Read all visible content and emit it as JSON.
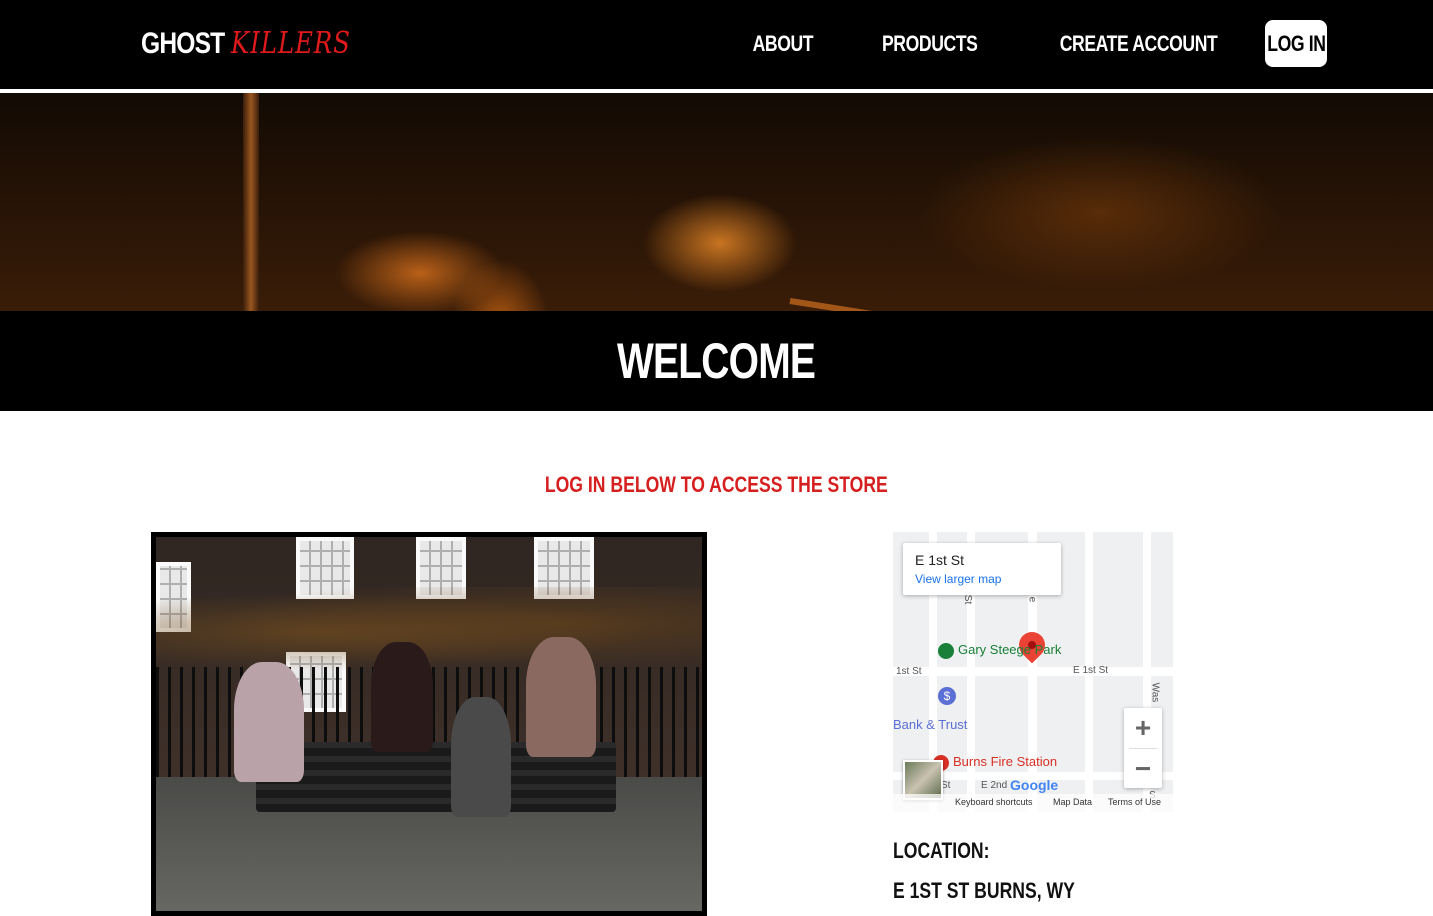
{
  "header": {
    "logo_white": "GHOST",
    "logo_red": "KILLERS",
    "nav": [
      "ABOUT",
      "PRODUCTS",
      "CREATE ACCOUNT"
    ],
    "login_label": "LOG IN"
  },
  "hero": {
    "title": "WELCOME"
  },
  "main": {
    "login_message": "LOG IN BELOW TO ACCESS THE STORE"
  },
  "map": {
    "card_title": "E 1st St",
    "card_link": "View larger map",
    "poi_park": "Gary Steege Park",
    "poi_bank": "Bank & Trust",
    "poi_fire": "Burns Fire Station",
    "street_e1st": "E 1st St",
    "street_1st": "1st St",
    "street_e2nd": "E 2nd",
    "street_st": "St",
    "street_was": "Was",
    "street_s": "S",
    "street_v_st": "St",
    "street_v_e": "e",
    "brand": "Google",
    "footer": [
      "Keyboard shortcuts",
      "Map Data",
      "Terms of Use"
    ],
    "zoom_in": "+",
    "zoom_out": "−",
    "colors": {
      "park": "#188038",
      "bank": "#5b6fd4",
      "fire": "#d93025",
      "pin": "#ea4335"
    }
  },
  "location": {
    "label": "LOCATION:",
    "address": "E 1ST ST BURNS, WY"
  }
}
